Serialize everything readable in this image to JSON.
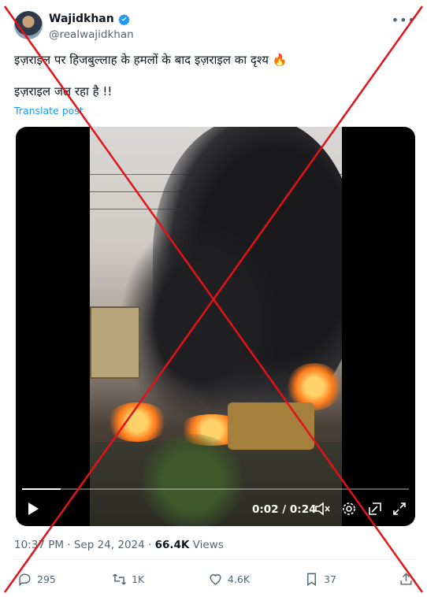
{
  "author": {
    "display_name": "Wajidkhan",
    "handle": "@realwajidkhan"
  },
  "post": {
    "line1": "इज़राइल पर हिजबुल्लाह के हमलों के बाद इज़राइल का दृश्य 🔥",
    "line2": "इज़राइल जल रहा है !!",
    "translate_label": "Translate post"
  },
  "video": {
    "time_display": "0:02 / 0:24",
    "progress_fraction": 0.1
  },
  "meta": {
    "timestamp": "10:37 PM · Sep 24, 2024 · ",
    "views_count": "66.4K",
    "views_label": " Views"
  },
  "actions": {
    "replies": "295",
    "reposts": "1K",
    "likes": "4.6K",
    "bookmarks": "37"
  },
  "colors": {
    "accent": "#1d9bf0",
    "muted": "#536471",
    "cross": "#e3121a"
  }
}
